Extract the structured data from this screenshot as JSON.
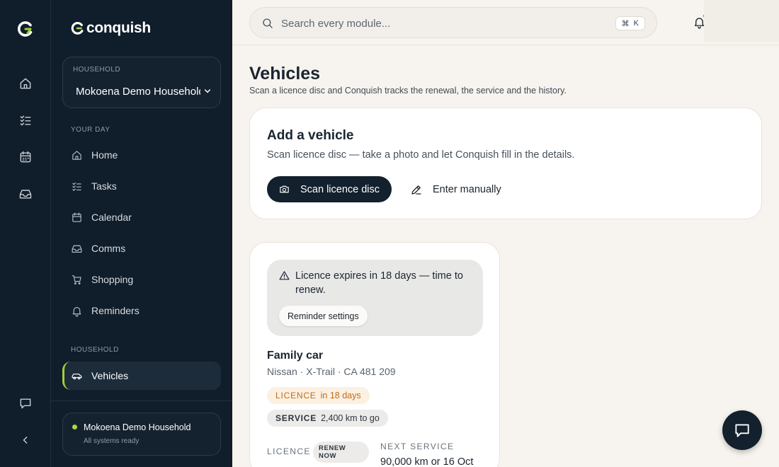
{
  "brand": {
    "name": "conquish"
  },
  "household_selector": {
    "caption": "HOUSEHOLD",
    "value": "Mokoena Demo Household"
  },
  "sidebar": {
    "section_your_day": "YOUR DAY",
    "section_household": "HOUSEHOLD",
    "items": [
      {
        "label": "Home",
        "icon": "home-icon"
      },
      {
        "label": "Tasks",
        "icon": "checklist-icon"
      },
      {
        "label": "Calendar",
        "icon": "calendar-icon"
      },
      {
        "label": "Comms",
        "icon": "inbox-icon"
      },
      {
        "label": "Shopping",
        "icon": "cart-icon"
      },
      {
        "label": "Reminders",
        "icon": "bell-icon"
      }
    ],
    "active_item": {
      "label": "Vehicles",
      "icon": "car-icon"
    },
    "status": {
      "name": "Mokoena Demo Household",
      "text": "All systems ready",
      "color": "#a6db3f"
    }
  },
  "topbar": {
    "search_placeholder": "Search every module...",
    "shortcut_symbol": "⌘",
    "shortcut_key": "K"
  },
  "page": {
    "title": "Vehicles",
    "subtitle": "Scan a licence disc and Conquish tracks the renewal, the service and the history."
  },
  "add_vehicle": {
    "title": "Add a vehicle",
    "description": "Scan licence disc — take a photo and let Conquish fill in the details.",
    "scan_label": "Scan licence disc",
    "manual_label": "Enter manually"
  },
  "vehicle": {
    "alert_text": "Licence expires in 18 days — time to renew.",
    "alert_button": "Reminder settings",
    "name": "Family car",
    "meta": "Nissan · X-Trail · CA 481 209",
    "licence_pill": {
      "key": "LICENCE",
      "value": "in 18 days"
    },
    "service_pill": {
      "key": "SERVICE",
      "value": "2,400 km to go"
    },
    "licence_label": "LICENCE",
    "renew_badge": "RENEW NOW",
    "next_service_label": "NEXT SERVICE",
    "next_service_value": "90,000 km or 16 Oct"
  },
  "colors": {
    "sidebar_bg": "#101d2a",
    "accent": "#a6db3f",
    "licence_pill": "#c56a16",
    "background": "#f7f4ef"
  }
}
